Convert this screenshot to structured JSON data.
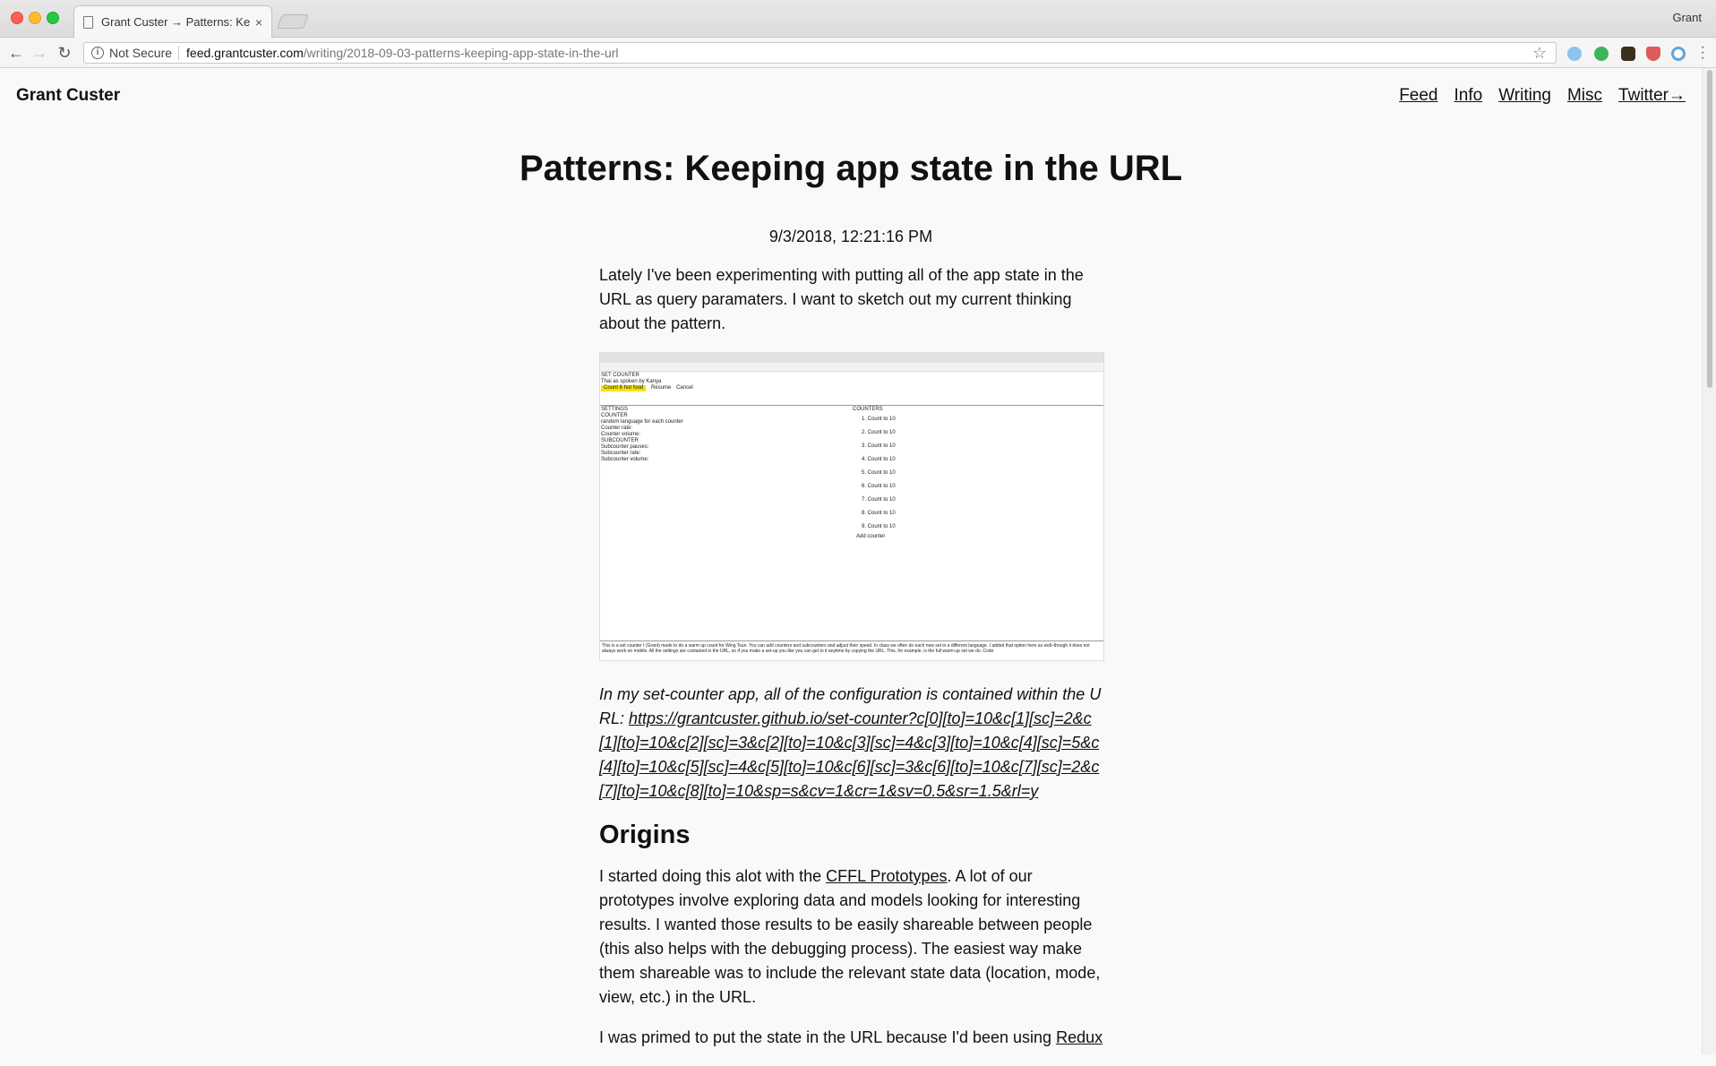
{
  "browser": {
    "tab_title": "Grant Custer → Patterns: Keep",
    "tab_close": "×",
    "profile_name": "Grant",
    "security_label": "Not Secure",
    "url_host": "feed.grantcuster.com",
    "url_path": "/writing/2018-09-03-patterns-keeping-app-state-in-the-url",
    "back_icon": "←",
    "forward_icon": "→",
    "reload_icon": "↻",
    "star_icon": "☆",
    "colors": {
      "close": "#fd5f57",
      "minimize": "#febc2e",
      "maximize": "#28c840"
    }
  },
  "site": {
    "title": "Grant Custer",
    "nav": [
      "Feed",
      "Info",
      "Writing",
      "Misc",
      "Twitter→"
    ]
  },
  "post": {
    "title": "Patterns: Keeping app state in the URL",
    "date": "9/3/2018, 12:21:16 PM",
    "intro": "Lately I've been experimenting with putting all of the app state in the URL as query paramaters. I want to sketch out my current thinking about the pattern.",
    "caption_text": "In my set-counter app, all of the configuration is contained within the URL: ",
    "caption_link": "https://grantcuster.github.io/set-counter?c[0][to]=10&c[1][sc]=2&c[1][to]=10&c[2][sc]=3&c[2][to]=10&c[3][sc]=4&c[3][to]=10&c[4][sc]=5&c[4][to]=10&c[5][sc]=4&c[5][to]=10&c[6][sc]=3&c[6][to]=10&c[7][sc]=2&c[7][to]=10&c[8][to]=10&sp=s&cv=1&cr=1&sv=0.5&sr=1.5&rl=y",
    "heading_origins": "Origins",
    "origins_p1_before": "I started doing this alot with the ",
    "origins_p1_link": "CFFL Prototypes",
    "origins_p1_after": ". A lot of our prototypes involve exploring data and models looking for interesting results. I wanted those results to be easily shareable between people (this also helps with the debugging process). The easiest way make them shareable was to include the relevant state data (location, mode, view, etc.) in the URL.",
    "origins_p2_before": "I was primed to put the state in the URL because I'd been using ",
    "origins_p2_link": "Redux"
  },
  "thumbnail": {
    "app_title": "SET COUNTER",
    "language": "Thai as spoken by Kanya",
    "btn_count": "Count 6 hot food",
    "btn_resume": "Resume",
    "btn_cancel": "Cancel",
    "settings_heading": "SETTINGS",
    "counter_heading": "COUNTER",
    "random_lang": "random language for each counter",
    "counter_rate": "Counter rate:",
    "counter_volume": "Counter volume:",
    "subcounter_heading": "SUBCOUNTER",
    "subcounter_pauses": "Subcounter pauses:",
    "subcounter_rate": "Subcounter rate:",
    "subcounter_volume": "Subcounter volume:",
    "counters_heading": "COUNTERS",
    "counters": [
      "1. Count to 10",
      "2. Count to 10",
      "3. Count to 10",
      "4. Count to 10",
      "5. Count to 10",
      "6. Count to 10",
      "7. Count to 10",
      "8. Count to 10",
      "9. Count to 10"
    ],
    "add_counter": "Add counter",
    "footer": "This is a set counter I (Grant) made to do a warm up count for Wing Tsun. You can add counters and subcounters and adjust their speed. In class we often do each new set in a different language. I added that option here as well–though it does not always work on mobile. All the settings are contained in the URL, so if you make a set-up you like you can get to it anytime by copying the URL. This, for example, is the full warm-up set we do. Code"
  }
}
